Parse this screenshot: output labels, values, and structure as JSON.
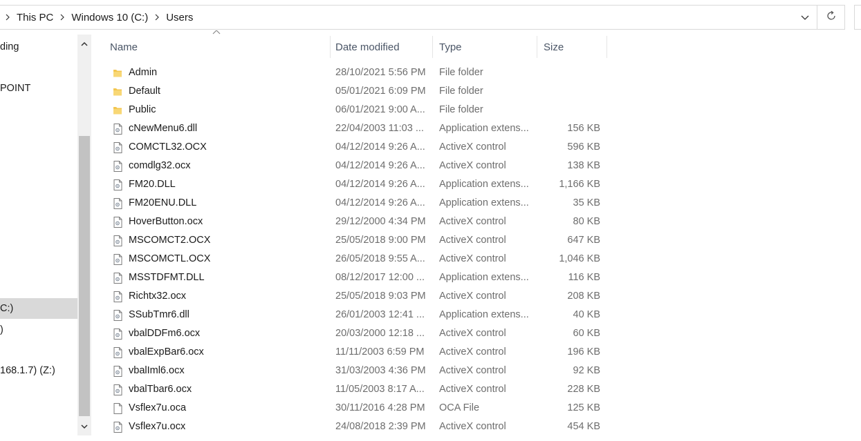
{
  "window": {
    "breadcrumb": [
      {
        "label": "This PC"
      },
      {
        "label": "Windows 10 (C:)"
      },
      {
        "label": "Users"
      }
    ]
  },
  "nav_pane": {
    "items": [
      {
        "label": "ding",
        "selected": false
      },
      {
        "label": "POINT",
        "selected": false
      },
      {
        "label": "C:)",
        "selected": true
      },
      {
        "label": ")",
        "selected": false
      },
      {
        "label": "168.1.7) (Z:)",
        "selected": false
      }
    ]
  },
  "columns": {
    "name": "Name",
    "date": "Date modified",
    "type": "Type",
    "size": "Size"
  },
  "files": [
    {
      "icon": "folder-icon",
      "name": "Admin",
      "date": "28/10/2021 5:56 PM",
      "type": "File folder",
      "size": ""
    },
    {
      "icon": "folder-icon",
      "name": "Default",
      "date": "05/01/2021 6:09 PM",
      "type": "File folder",
      "size": ""
    },
    {
      "icon": "folder-icon",
      "name": "Public",
      "date": "06/01/2021 9:00 A...",
      "type": "File folder",
      "size": ""
    },
    {
      "icon": "dll-file-icon",
      "name": "cNewMenu6.dll",
      "date": "22/04/2003 11:03 ...",
      "type": "Application extens...",
      "size": "156 KB"
    },
    {
      "icon": "ocx-file-icon",
      "name": "COMCTL32.OCX",
      "date": "04/12/2014 9:26 A...",
      "type": "ActiveX control",
      "size": "596 KB"
    },
    {
      "icon": "ocx-file-icon",
      "name": "comdlg32.ocx",
      "date": "04/12/2014 9:26 A...",
      "type": "ActiveX control",
      "size": "138 KB"
    },
    {
      "icon": "dll-file-icon",
      "name": "FM20.DLL",
      "date": "04/12/2014 9:26 A...",
      "type": "Application extens...",
      "size": "1,166 KB"
    },
    {
      "icon": "dll-file-icon",
      "name": "FM20ENU.DLL",
      "date": "04/12/2014 9:26 A...",
      "type": "Application extens...",
      "size": "35 KB"
    },
    {
      "icon": "ocx-file-icon",
      "name": "HoverButton.ocx",
      "date": "29/12/2000 4:34 PM",
      "type": "ActiveX control",
      "size": "80 KB"
    },
    {
      "icon": "ocx-file-icon",
      "name": "MSCOMCT2.OCX",
      "date": "25/05/2018 9:00 PM",
      "type": "ActiveX control",
      "size": "647 KB"
    },
    {
      "icon": "ocx-file-icon",
      "name": "MSCOMCTL.OCX",
      "date": "26/05/2018 9:55 A...",
      "type": "ActiveX control",
      "size": "1,046 KB"
    },
    {
      "icon": "dll-file-icon",
      "name": "MSSTDFMT.DLL",
      "date": "08/12/2017 12:00 ...",
      "type": "Application extens...",
      "size": "116 KB"
    },
    {
      "icon": "ocx-file-icon",
      "name": "Richtx32.ocx",
      "date": "25/05/2018 9:03 PM",
      "type": "ActiveX control",
      "size": "208 KB"
    },
    {
      "icon": "dll-file-icon",
      "name": "SSubTmr6.dll",
      "date": "26/01/2003 12:41 ...",
      "type": "Application extens...",
      "size": "40 KB"
    },
    {
      "icon": "ocx-file-icon",
      "name": "vbalDDFm6.ocx",
      "date": "20/03/2000 12:18 ...",
      "type": "ActiveX control",
      "size": "60 KB"
    },
    {
      "icon": "ocx-file-icon",
      "name": "vbalExpBar6.ocx",
      "date": "11/11/2003 6:59 PM",
      "type": "ActiveX control",
      "size": "196 KB"
    },
    {
      "icon": "ocx-file-icon",
      "name": "vbalIml6.ocx",
      "date": "31/03/2003 4:36 PM",
      "type": "ActiveX control",
      "size": "92 KB"
    },
    {
      "icon": "ocx-file-icon",
      "name": "vbalTbar6.ocx",
      "date": "11/05/2003 8:17 A...",
      "type": "ActiveX control",
      "size": "228 KB"
    },
    {
      "icon": "blank-file-icon",
      "name": "Vsflex7u.oca",
      "date": "30/11/2016 4:28 PM",
      "type": "OCA File",
      "size": "125 KB"
    },
    {
      "icon": "ocx-file-icon",
      "name": "Vsflex7u.ocx",
      "date": "24/08/2018 2:39 PM",
      "type": "ActiveX control",
      "size": "454 KB"
    }
  ],
  "colors": {
    "folder": "#f3c64f",
    "selection": "#d9d9d9",
    "header_text": "#4a5566",
    "secondary_text": "#6d6d6d"
  }
}
